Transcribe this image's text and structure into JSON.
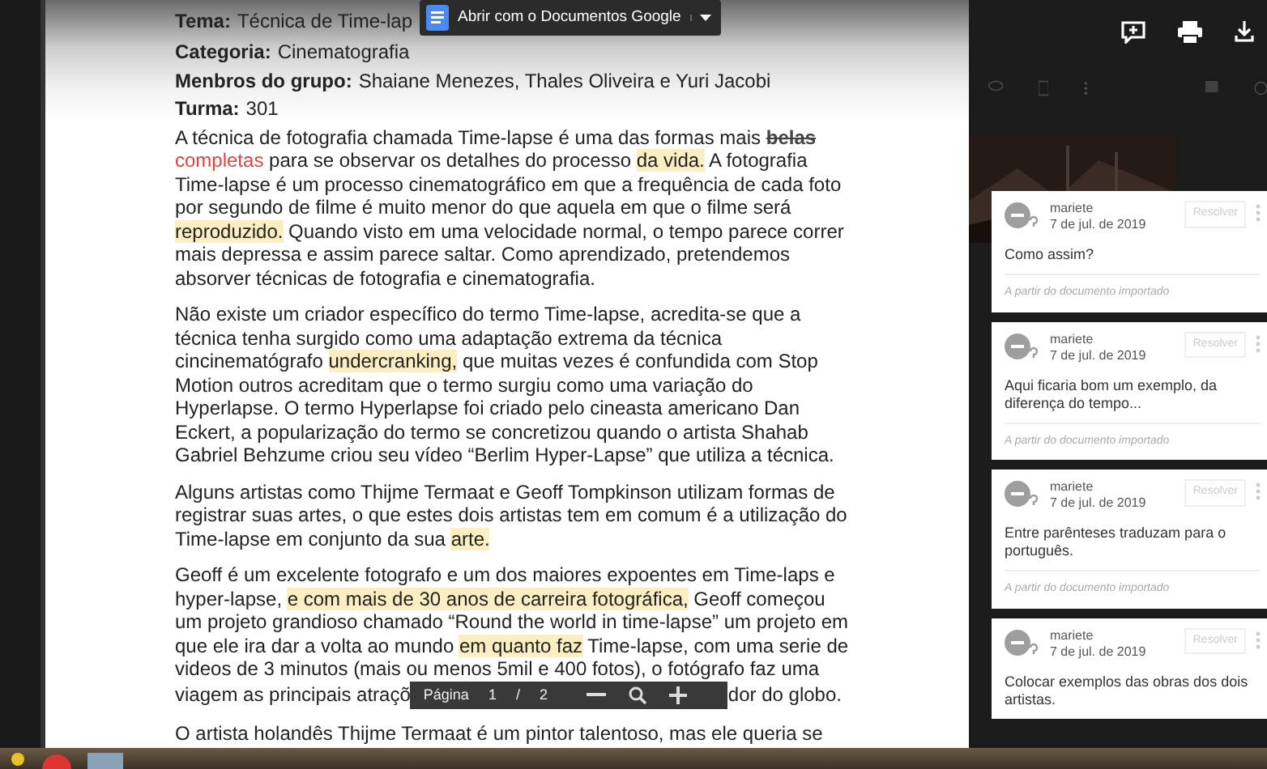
{
  "open_with_button": {
    "label": "Abrir com o Documentos Google"
  },
  "document": {
    "header_lines": [
      {
        "label": "Tema:",
        "value": "Técnica de Time-lap"
      },
      {
        "label": "Categoria:",
        "value": "Cinematografia"
      },
      {
        "label": "Menbros do grupo:",
        "value": "Shaiane Menezes, Thales Oliveira e Yuri Jacobi"
      },
      {
        "label": "Turma:",
        "value": "301"
      }
    ],
    "paragraphs": [
      [
        {
          "kind": "plain",
          "text": "A técnica de fotografia chamada Time-lapse é uma das formas mais "
        },
        {
          "kind": "struck",
          "text": "belas"
        },
        {
          "kind": "inserted",
          "text": "completas"
        },
        {
          "kind": "plain",
          "text": " para se observar os detalhes do processo "
        },
        {
          "kind": "highlight",
          "text": "da vida."
        },
        {
          "kind": "plain",
          "text": " A fotografia Time-lapse é um processo cinematográfico em que a frequência de cada foto por segundo de filme é muito menor do que aquela em que o filme será "
        },
        {
          "kind": "highlight",
          "text": "reproduzido."
        },
        {
          "kind": "plain",
          "text": " Quando visto em uma velocidade normal, o tempo parece correr mais depressa e assim parece saltar. Como aprendizado, pretendemos absorver técnicas de fotografia e cinematografia."
        }
      ],
      [
        {
          "kind": "plain",
          "text": "Não existe um criador específico do termo Time-lapse, acredita-se que a técnica tenha surgido como uma adaptação extrema da técnica cincinematógrafo "
        },
        {
          "kind": "highlight",
          "text": "undercranking,"
        },
        {
          "kind": "plain",
          "text": " que muitas vezes é confundida com Stop Motion outros acreditam que o termo surgiu como uma variação do Hyperlapse. O termo Hyperlapse foi criado pelo cineasta americano Dan Eckert, a popularização do termo se concretizou quando o artista Shahab Gabriel Behzume criou seu vídeo “Berlim Hyper-Lapse” que utiliza a técnica."
        }
      ],
      [
        {
          "kind": "plain",
          "text": "Alguns artistas como Thijme Termaat e Geoff Tompkinson utilizam formas de registrar suas artes, o que estes dois artistas tem em comum é a utilização do Time-lapse em conjunto da sua "
        },
        {
          "kind": "highlight",
          "text": "arte."
        }
      ],
      [
        {
          "kind": "plain",
          "text": "Geoff é um excelente fotografo e um dos maiores expoentes em Time-laps e hyper-lapse, "
        },
        {
          "kind": "highlight",
          "text": "e com mais de 30 anos de carreira fotográfica,"
        },
        {
          "kind": "plain",
          "text": " Geoff começou um projeto grandioso chamado “Round the world in time-lapse” um projeto em que ele ira dar a volta ao mundo "
        },
        {
          "kind": "highlight",
          "text": "em quanto faz"
        },
        {
          "kind": "plain",
          "text": " Time-lapse, com uma serie de videos de 3 minutos (mais ou menos 5mil e 400 fotos), o fotógrafo faz uma"
        },
        {
          "kind": "covered_line",
          "before": "viagem as principais atraçõ",
          "after": "dor do globo."
        }
      ],
      [
        {
          "kind": "plain",
          "text": "O artista holandês Thijme Termaat é um pintor talentoso, mas ele queria se"
        }
      ]
    ]
  },
  "pager": {
    "label": "Página",
    "page": "1",
    "separator": "/",
    "total": "2"
  },
  "comments": [
    {
      "author": "mariete",
      "date": "7 de jul. de 2019",
      "resolve": "Resolver",
      "text": "Como assim?",
      "footer": "A partir do documento importado"
    },
    {
      "author": "mariete",
      "date": "7 de jul. de 2019",
      "resolve": "Resolver",
      "text": "Aqui ficaria bom um exemplo, da diferença do tempo...",
      "footer": "A partir do documento importado"
    },
    {
      "author": "mariete",
      "date": "7 de jul. de 2019",
      "resolve": "Resolver",
      "text": "Entre parênteses traduzam para o português.",
      "footer": "A partir do documento importado"
    },
    {
      "author": "mariete",
      "date": "7 de jul. de 2019",
      "resolve": "Resolver",
      "text": "Colocar exemplos das obras dos dois artistas."
    }
  ]
}
